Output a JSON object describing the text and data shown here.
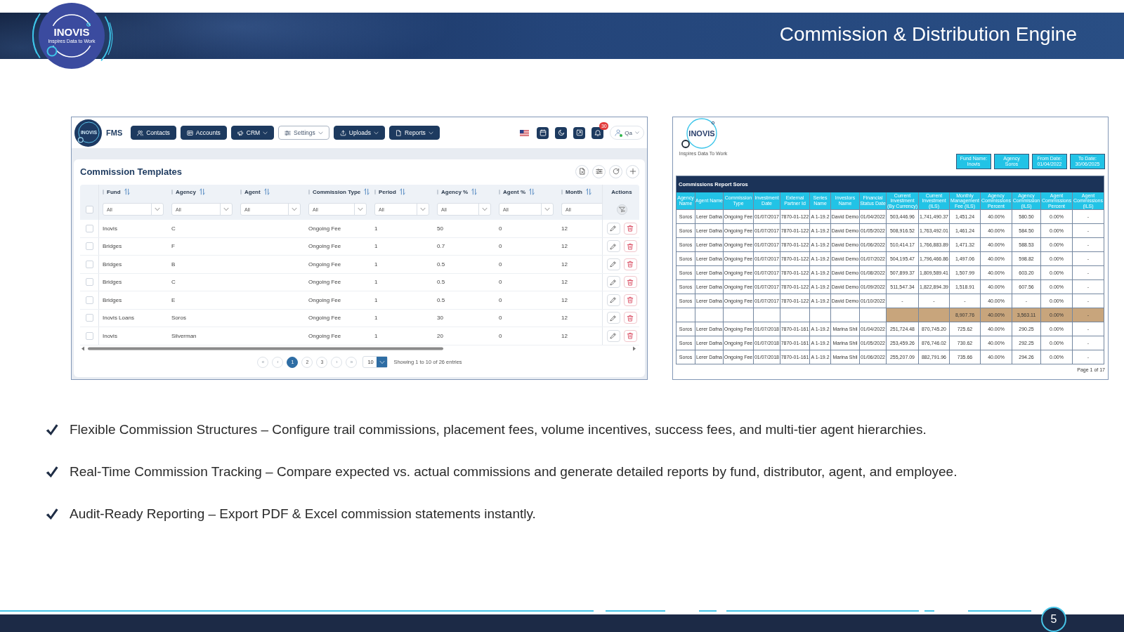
{
  "header": {
    "logo": {
      "wordmark": "INOVIS",
      "tagline": "Inspires Data to Work"
    },
    "title": "Commission & Distribution Engine"
  },
  "app_window": {
    "navbar": {
      "logo_text": "INOVIS",
      "brand": "FMS",
      "menu": [
        {
          "label": "Contacts",
          "selected": false,
          "dropdown": false
        },
        {
          "label": "Accounts",
          "selected": false,
          "dropdown": false
        },
        {
          "label": "CRM",
          "selected": false,
          "dropdown": true
        },
        {
          "label": "Settings",
          "selected": true,
          "dropdown": true
        },
        {
          "label": "Uploads",
          "selected": false,
          "dropdown": true
        },
        {
          "label": "Reports",
          "selected": false,
          "dropdown": true
        }
      ],
      "notification_count": "30",
      "user": {
        "name": "Qa",
        "online": true
      }
    },
    "page_title": "Commission Templates",
    "table": {
      "select_all": {
        "checked": false
      },
      "columns": [
        {
          "label": "Fund",
          "filter": "All"
        },
        {
          "label": "Agency",
          "filter": "All"
        },
        {
          "label": "Agent",
          "filter": "All"
        },
        {
          "label": "Commission Type",
          "filter": "All"
        },
        {
          "label": "Period",
          "filter": "All"
        },
        {
          "label": "Agency %",
          "filter": "All"
        },
        {
          "label": "Agent %",
          "filter": "All"
        },
        {
          "label": "Month",
          "filter": "All"
        }
      ],
      "actions_label": "Actions",
      "rows": [
        {
          "checked": false,
          "fund": "Inovis",
          "agency": "C",
          "commission_type": "Ongoing Fee",
          "period": "1",
          "agency_percent": "50",
          "agent_percent": "0",
          "month": "12"
        },
        {
          "checked": false,
          "fund": "Bridges",
          "agency": "F",
          "commission_type": "Ongoing Fee",
          "period": "1",
          "agency_percent": "0.7",
          "agent_percent": "0",
          "month": "12"
        },
        {
          "checked": false,
          "fund": "Bridges",
          "agency": "B",
          "commission_type": "Ongoing Fee",
          "period": "1",
          "agency_percent": "0.5",
          "agent_percent": "0",
          "month": "12"
        },
        {
          "checked": false,
          "fund": "Bridges",
          "agency": "C",
          "commission_type": "Ongoing Fee",
          "period": "1",
          "agency_percent": "0.5",
          "agent_percent": "0",
          "month": "12"
        },
        {
          "checked": false,
          "fund": "Bridges",
          "agency": "E",
          "commission_type": "Ongoing Fee",
          "period": "1",
          "agency_percent": "0.5",
          "agent_percent": "0",
          "month": "12"
        },
        {
          "checked": false,
          "fund": "Inovis Loans",
          "agency": "Soros",
          "commission_type": "Ongoing Fee",
          "period": "1",
          "agency_percent": "30",
          "agent_percent": "0",
          "month": "12"
        },
        {
          "checked": false,
          "fund": "Inovis",
          "agency": "Silverman",
          "commission_type": "Ongoing Fee",
          "period": "1",
          "agency_percent": "20",
          "agent_percent": "0",
          "month": "12"
        }
      ]
    },
    "pagination": {
      "first": "«",
      "previous": "‹",
      "pages": [
        {
          "label": "1",
          "selected": true
        },
        {
          "label": "2",
          "selected": false
        },
        {
          "label": "3",
          "selected": false
        }
      ],
      "next": "›",
      "last": "»",
      "page_size": "10",
      "info": "Showing 1 to 10 of 26 entries"
    }
  },
  "report": {
    "logo": {
      "wordmark": "INOVIS",
      "tagline": "Inspires Data To Work"
    },
    "filters": [
      {
        "label": "Fund Name:",
        "value": "Inovis"
      },
      {
        "label": "Agency",
        "value": "Soros"
      },
      {
        "label": "From Date:",
        "value": "01/04/2022"
      },
      {
        "label": "To Date:",
        "value": "30/06/2025"
      }
    ],
    "title": "Commissions Report Soros",
    "columns": [
      {
        "label": "Agency Name",
        "kind": "text"
      },
      {
        "label": "Agent Name",
        "kind": "text"
      },
      {
        "label": "Commission Type",
        "kind": "text"
      },
      {
        "label": "Investment Date",
        "kind": "text"
      },
      {
        "label": "External Partner Id",
        "kind": "text"
      },
      {
        "label": "Series Name",
        "kind": "text"
      },
      {
        "label": "Investors Name",
        "kind": "text"
      },
      {
        "label": "Financial Status Date",
        "kind": "text"
      },
      {
        "label": "Current Investment (By Currency)",
        "kind": "amount"
      },
      {
        "label": "Current Investment (ILS)",
        "kind": "amount"
      },
      {
        "label": "Monthly Management Fee (ILS)",
        "kind": "amount"
      },
      {
        "label": "Agency Commissions Percent",
        "kind": "amount"
      },
      {
        "label": "Agency Commission (ILS)",
        "kind": "amount"
      },
      {
        "label": "Agent Commissions Percent",
        "kind": "amount"
      },
      {
        "label": "Agent Commissions (ILS)",
        "kind": "amount"
      }
    ],
    "rows": [
      {
        "kind": "entry",
        "cells": [
          "Soros",
          "Lerer Dafna",
          "Ongoing Fee",
          "01/07/2017",
          "7870-01-122",
          "A 1-19.2",
          "David Demo",
          "01/04/2022",
          "503,446.96",
          "1,741,490.37",
          "1,451.24",
          "40.00%",
          "580.50",
          "0.00%",
          "-"
        ]
      },
      {
        "kind": "entry",
        "cells": [
          "Soros",
          "Lerer Dafna",
          "Ongoing Fee",
          "01/07/2017",
          "7870-01-122",
          "A 1-19.2",
          "David Demo",
          "01/05/2022",
          "508,916.52",
          "1,763,492.01",
          "1,461.24",
          "40.00%",
          "584.50",
          "0.00%",
          "-"
        ]
      },
      {
        "kind": "entry",
        "cells": [
          "Soros",
          "Lerer Dafna",
          "Ongoing Fee",
          "01/07/2017",
          "7870-01-122",
          "A 1-19.2",
          "David Demo",
          "01/06/2022",
          "510,414.17",
          "1,766,883.89",
          "1,471.32",
          "40.00%",
          "588.53",
          "0.00%",
          "-"
        ]
      },
      {
        "kind": "entry",
        "cells": [
          "Soros",
          "Lerer Dafna",
          "Ongoing Fee",
          "01/07/2017",
          "7870-01-122",
          "A 1-19.2",
          "David Demo",
          "01/07/2022",
          "504,195.47",
          "1,796,466.86",
          "1,497.06",
          "40.00%",
          "598.82",
          "0.00%",
          "-"
        ]
      },
      {
        "kind": "entry",
        "cells": [
          "Soros",
          "Lerer Dafna",
          "Ongoing Fee",
          "01/07/2017",
          "7870-01-122",
          "A 1-19.2",
          "David Demo",
          "01/08/2022",
          "507,899.37",
          "1,809,589.41",
          "1,507.99",
          "40.00%",
          "603.20",
          "0.00%",
          "-"
        ]
      },
      {
        "kind": "entry",
        "cells": [
          "Soros",
          "Lerer Dafna",
          "Ongoing Fee",
          "01/07/2017",
          "7870-01-122",
          "A 1-19.2",
          "David Demo",
          "01/09/2022",
          "511,547.34",
          "1,822,894.39",
          "1,518.91",
          "40.00%",
          "607.56",
          "0.00%",
          "-"
        ]
      },
      {
        "kind": "entry",
        "cells": [
          "Soros",
          "Lerer Dafna",
          "Ongoing Fee",
          "01/07/2017",
          "7870-01-122",
          "A 1-19.2",
          "David Demo",
          "01/10/2022",
          "-",
          "-",
          "-",
          "40.00%",
          "-",
          "0.00%",
          "-"
        ]
      },
      {
        "kind": "subtotal",
        "cells": [
          "",
          "",
          "",
          "",
          "",
          "",
          "",
          "",
          "",
          "",
          "8,907.76",
          "40.00%",
          "3,563.11",
          "0.00%",
          "-"
        ]
      },
      {
        "kind": "entry",
        "cells": [
          "Soros",
          "Lerer Dafna",
          "Ongoing Fee",
          "01/07/2018",
          "7870-01-161",
          "A 1-19.2",
          "Marina Shil",
          "01/04/2022",
          "251,724.48",
          "870,745.20",
          "725.62",
          "40.00%",
          "290.25",
          "0.00%",
          "-"
        ]
      },
      {
        "kind": "entry",
        "cells": [
          "Soros",
          "Lerer Dafna",
          "Ongoing Fee",
          "01/07/2018",
          "7870-01-161",
          "A 1-19.2",
          "Marina Shil",
          "01/05/2022",
          "253,459.26",
          "876,746.02",
          "730.62",
          "40.00%",
          "292.25",
          "0.00%",
          "-"
        ]
      },
      {
        "kind": "entry",
        "cells": [
          "Soros",
          "Lerer Dafna",
          "Ongoing Fee",
          "01/07/2018",
          "7870-01-161",
          "A 1-19.2",
          "Marina Shil",
          "01/06/2022",
          "255,207.09",
          "882,791.96",
          "735.66",
          "40.00%",
          "294.26",
          "0.00%",
          "-"
        ]
      }
    ],
    "page_label": "Page 1 of 17"
  },
  "features": [
    {
      "text": "Flexible Commission Structures – Configure trail commissions, placement fees, volume incentives, success fees, and multi-tier agent hierarchies."
    },
    {
      "text": "Real-Time Commission Tracking – Compare expected vs. actual commissions and generate detailed reports by fund, distributor, agent, and employee."
    },
    {
      "text": "Audit-Ready Reporting – Export PDF & Excel commission statements instantly."
    }
  ],
  "footer": {
    "page_number": "5"
  }
}
